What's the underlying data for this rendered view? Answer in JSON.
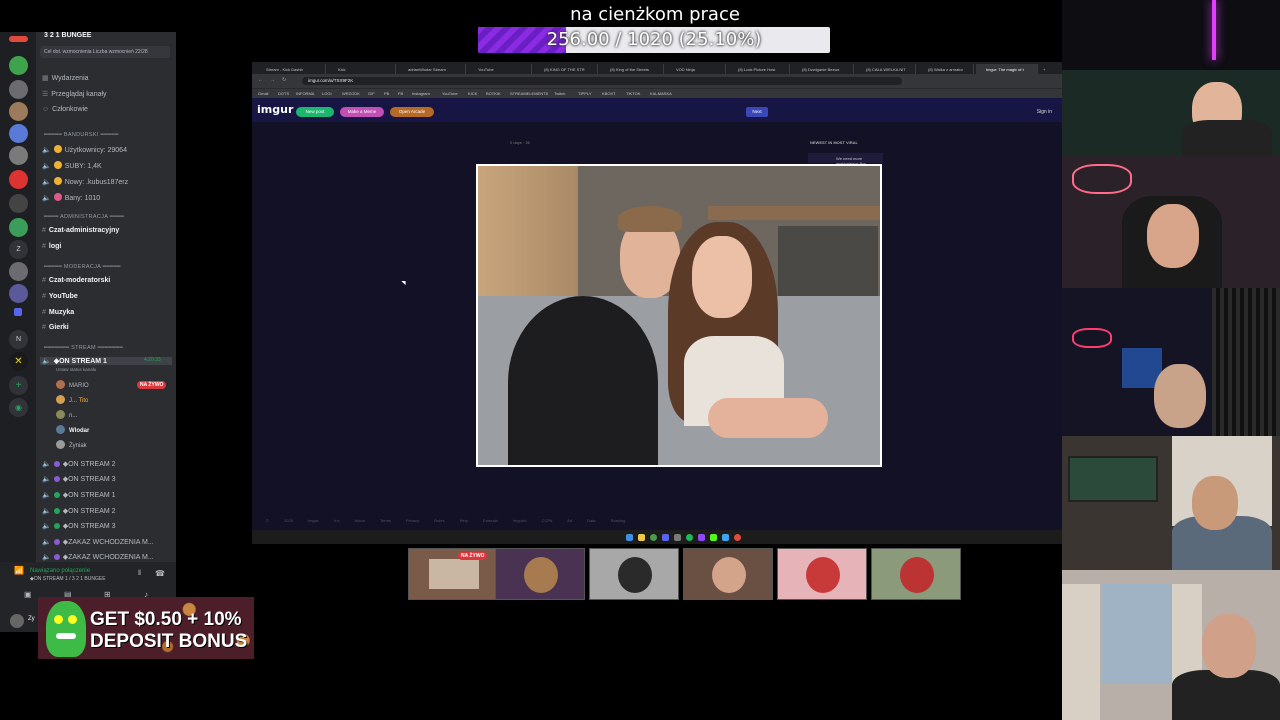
{
  "goal": {
    "title": "na cienżkom prace",
    "text": "256.00 / 1020 (25.10%)",
    "progress": 0.251
  },
  "discord": {
    "server_name": "3 2 1 BUNGEE",
    "boost_goal": "Cel dot. wzmocnienia Liczba wzmocnień 22/28",
    "menu": [
      "Wydarzenia",
      "Przeglądaj kanały",
      "Członkowie"
    ],
    "categories": {
      "banduriski": "BANDURSKI",
      "admin": "ADMINISTRACJA",
      "mod": "MODERACJA",
      "stream": "STREAM"
    },
    "stats": [
      "Użytkownicy: 29064",
      "SUBY: 1,4K",
      "Nowy: .kubus187erz",
      "Bany: 1010"
    ],
    "admin_channels": [
      "Czat-administracyjny",
      "logi"
    ],
    "mod_channels": [
      "Czat-moderatorski",
      "YouTube",
      "Muzyka",
      "Gierki"
    ],
    "stream_channel": "◆ON STREAM 1",
    "stream_time": "4:20:33",
    "stream_status": "Ustaw status kanału",
    "live_badge": "NA ŻYWO",
    "voice_users": [
      "MARIO",
      "J...",
      "n...",
      "Wlodar",
      "Żyniak"
    ],
    "voice_user_tag": "Tito",
    "other_channels": [
      "◆ON STREAM 2",
      "◆ON STREAM 3",
      "◆ON STREAM 1",
      "◆ON STREAM 2",
      "◆ON STREAM 3",
      "◆ZAKAZ WCHODZENIA M...",
      "◆ZAKAZ WCHODZENIA M..."
    ],
    "voice_status": "Nawiązano połączenie",
    "voice_sub": "◆ON STREAM 1 / 3 2 1 BUNGEE",
    "user_short": "Zy"
  },
  "ad": {
    "line1": "GET $0.50 + 10%",
    "line2": "DEPOSIT BONUS"
  },
  "browser": {
    "tabs": [
      "Stream - Kick Dashb",
      "Kick",
      "adrianWlodar Stream",
      "YouTube",
      "(8) KING OF THE STR",
      "(8) King of the Streets",
      "VOD Ninja",
      "(8) Lock Picture Host",
      "(8) Dzwiganie Bezwz",
      "(8) CAŁA WIELKA NIT",
      "(8) Walka z armator",
      "Imgur: The magic of t"
    ],
    "url": "imgur.com/a/TSX9F2K",
    "bookmarks": [
      "Gmail",
      "DOTS",
      "INFORMA",
      "LOGI",
      "WRZODK",
      "GIF",
      "PB",
      "FB",
      "Instagram",
      "YouTube",
      "KICK",
      "BOTKIK",
      "STREAMELEMENTS",
      "Twitch",
      "TIPPLY",
      "KBOXT",
      "TIKTOK",
      "KIA-MASKA"
    ],
    "imgur": {
      "logo": "imgur",
      "new_post": "New post",
      "make_meme": "Make a Meme",
      "open_arcade": "Open Arcade",
      "search_btn": "Next",
      "sign_in": "Sign in"
    },
    "post_meta": "0 days · 36",
    "newest_title": "NEWEST IN MOST VIRAL",
    "newest_item": "We need more ambivalence like",
    "footer": "© 2025 Imgur, Inc  About  Terms  Privacy  Rules  Help  Emerald  Imgurfo  CCPA  Ad Data  Ranking"
  },
  "thumb_live": "NA ŻYWO",
  "colors": {
    "accent": "#8a2be2",
    "live": "#da373c",
    "discord_bg": "#2b2d31",
    "imgur_bg": "#121126"
  }
}
